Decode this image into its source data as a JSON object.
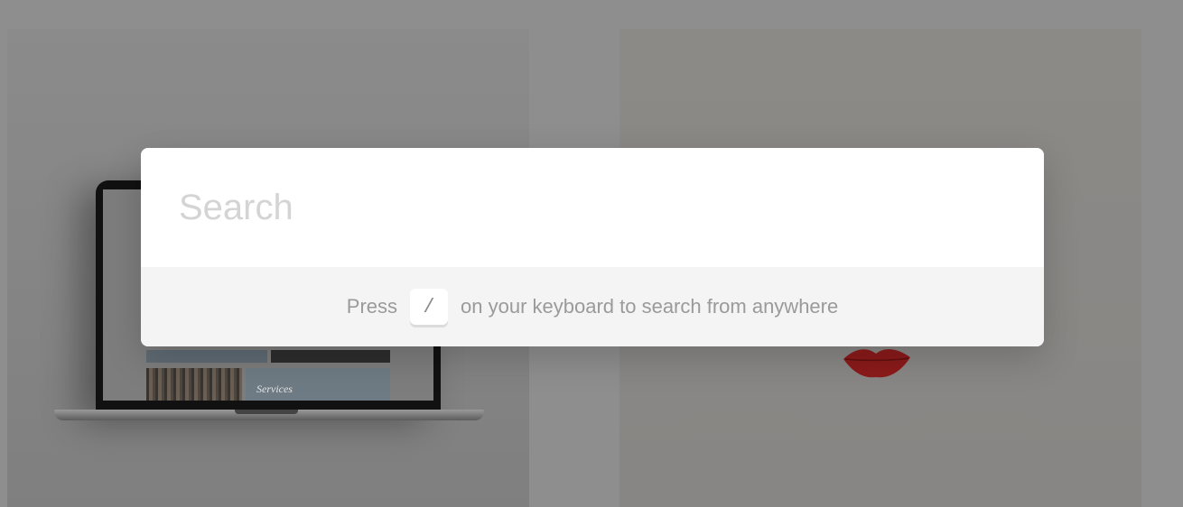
{
  "background": {
    "left_tile": {
      "laptop_screen_label": "Services"
    }
  },
  "search": {
    "placeholder": "Search",
    "value": ""
  },
  "hint": {
    "prefix": "Press",
    "key": "/",
    "suffix": "on your keyboard to search from anywhere"
  },
  "icons": {
    "laptop": "laptop-image",
    "lips": "lips-image"
  },
  "colors": {
    "overlay": "#8e8e8e",
    "modal_bg": "#ffffff",
    "hint_bg": "#f4f4f4",
    "hint_text": "#9a9a9a",
    "placeholder": "#d4d4d4",
    "lips_red": "#8b1a1a"
  }
}
